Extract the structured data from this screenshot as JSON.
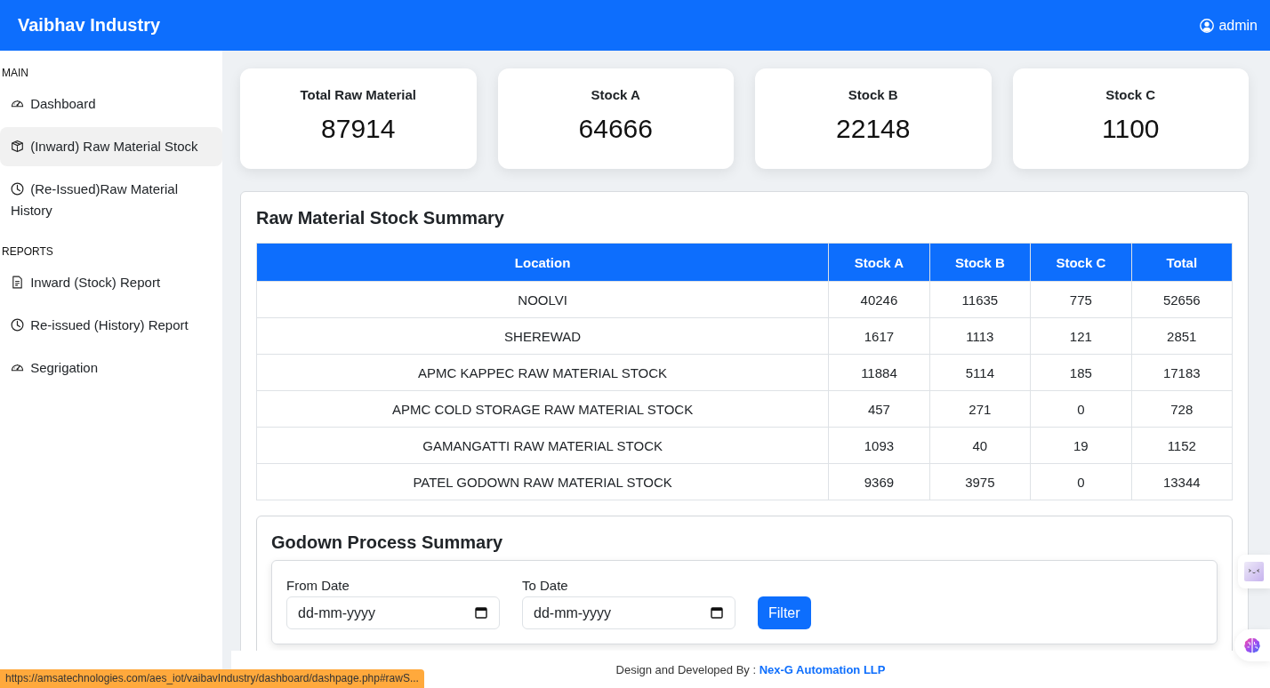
{
  "header": {
    "brand": "Vaibhav Industry",
    "user": "admin"
  },
  "sidebar": {
    "sections": [
      {
        "heading": "MAIN",
        "items": [
          {
            "label": "Dashboard",
            "selected": false
          },
          {
            "label": "(Inward) Raw Material Stock",
            "selected": true
          },
          {
            "label": "(Re-Issued)Raw Material History",
            "selected": false
          }
        ]
      },
      {
        "heading": "REPORTS",
        "items": [
          {
            "label": "Inward (Stock) Report",
            "selected": false
          },
          {
            "label": "Re-issued (History) Report",
            "selected": false
          },
          {
            "label": "Segrigation",
            "selected": false
          }
        ]
      }
    ]
  },
  "stat_cards": [
    {
      "label": "Total Raw Material",
      "value": "87914"
    },
    {
      "label": "Stock A",
      "value": "64666"
    },
    {
      "label": "Stock B",
      "value": "22148"
    },
    {
      "label": "Stock C",
      "value": "1100"
    }
  ],
  "stock_summary": {
    "title": "Raw Material Stock Summary",
    "table": {
      "columns": [
        "Location",
        "Stock A",
        "Stock B",
        "Stock C",
        "Total"
      ],
      "rows": [
        [
          "NOOLVI",
          "40246",
          "11635",
          "775",
          "52656"
        ],
        [
          "SHEREWAD",
          "1617",
          "1113",
          "121",
          "2851"
        ],
        [
          "APMC KAPPEC RAW MATERIAL STOCK",
          "11884",
          "5114",
          "185",
          "17183"
        ],
        [
          "APMC COLD STORAGE RAW MATERIAL STOCK",
          "457",
          "271",
          "0",
          "728"
        ],
        [
          "GAMANGATTI RAW MATERIAL STOCK",
          "1093",
          "40",
          "19",
          "1152"
        ],
        [
          "PATEL GODOWN RAW MATERIAL STOCK",
          "9369",
          "3975",
          "0",
          "13344"
        ]
      ]
    }
  },
  "godown_summary": {
    "title": "Godown Process Summary",
    "filters": [
      {
        "label": "From Date",
        "placeholder": "dd-mm-yyyy"
      },
      {
        "label": "To Date",
        "placeholder": "dd-mm-yyyy"
      }
    ],
    "button": "Filter"
  },
  "footer": {
    "text": "Design and Developed By :",
    "link": "Nex-G Automation LLP"
  },
  "status_url": "https://amsatechnologies.com/aes_iot/vaibavIndustry/dashboard/dashpage.php#rawS..."
}
